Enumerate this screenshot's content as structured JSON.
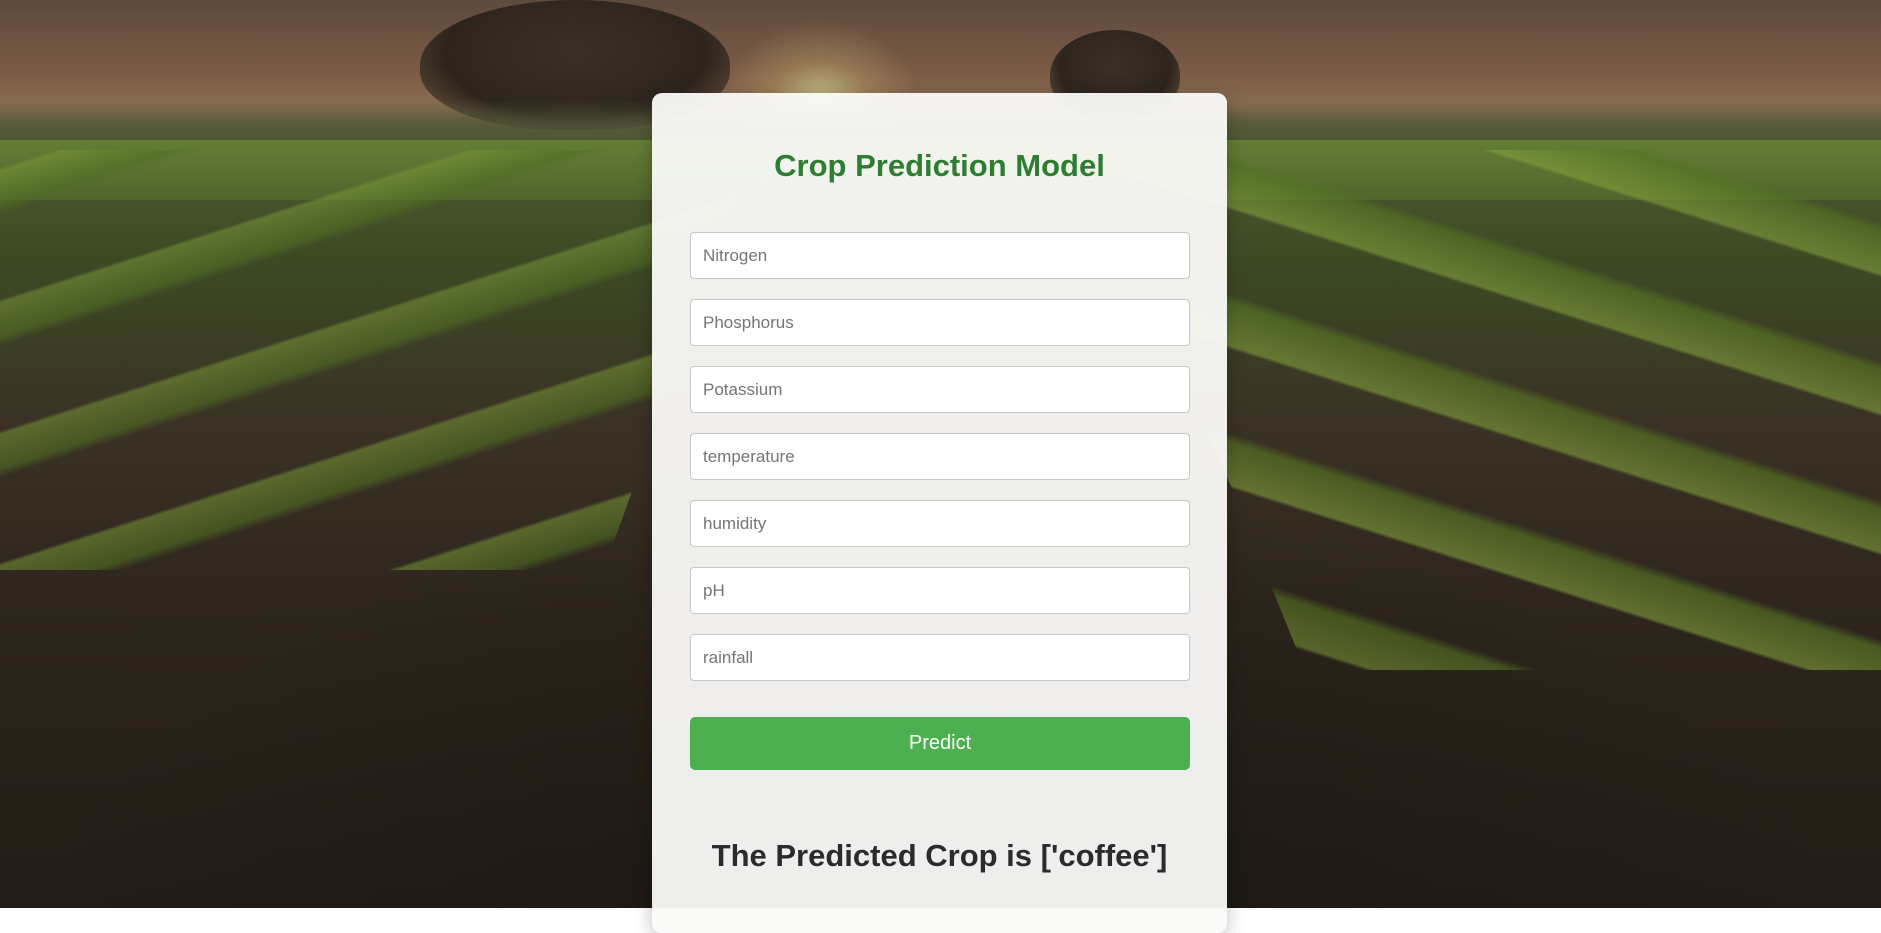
{
  "page": {
    "title": "Crop Prediction Model"
  },
  "form": {
    "fields": [
      {
        "name": "Nitrogen",
        "placeholder": "Nitrogen",
        "value": ""
      },
      {
        "name": "Phosphorus",
        "placeholder": "Phosphorus",
        "value": ""
      },
      {
        "name": "Potassium",
        "placeholder": "Potassium",
        "value": ""
      },
      {
        "name": "temperature",
        "placeholder": "temperature",
        "value": ""
      },
      {
        "name": "humidity",
        "placeholder": "humidity",
        "value": ""
      },
      {
        "name": "pH",
        "placeholder": "pH",
        "value": ""
      },
      {
        "name": "rainfall",
        "placeholder": "rainfall",
        "value": ""
      }
    ],
    "submit_label": "Predict"
  },
  "result": {
    "text": "The Predicted Crop is ['coffee']"
  },
  "colors": {
    "title": "#2e7d32",
    "button": "#4caf50",
    "button_text": "#ffffff",
    "card": "#fafaf8"
  },
  "background": {
    "description_icon": "farm-field-sunset-background"
  }
}
